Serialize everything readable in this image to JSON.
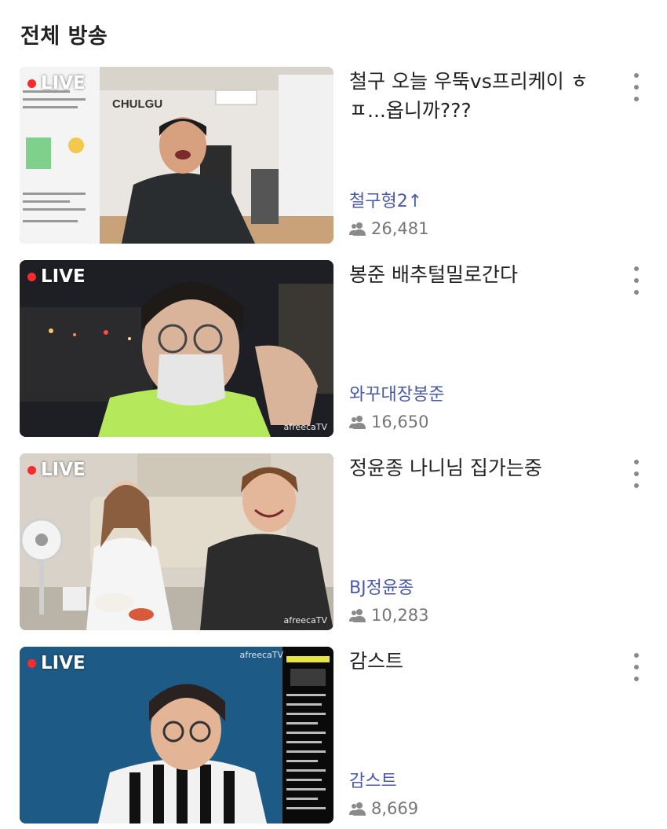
{
  "section": {
    "title": "전체 방송"
  },
  "streams": [
    {
      "live_label": "LIVE",
      "title": "철구 오늘 우뚝vs프리케이 ㅎㅍ...옵니까???",
      "streamer": "철구형2↑",
      "viewers": "26,481",
      "room_sign": "CHULGU"
    },
    {
      "live_label": "LIVE",
      "title": "봉준 배추털밀로간다",
      "streamer": "와꾸대장봉준",
      "viewers": "16,650",
      "watermark": "afreecaTV"
    },
    {
      "live_label": "LIVE",
      "title": "정윤종 나니님 집가는중",
      "streamer": "BJ정윤종",
      "viewers": "10,283",
      "watermark": "afreecaTV"
    },
    {
      "live_label": "LIVE",
      "title": "감스트",
      "streamer": "감스트",
      "viewers": "8,669",
      "watermark": "afreecaTV"
    }
  ],
  "icons": {
    "viewers": "people-icon",
    "more": "more-vertical-icon",
    "live": "live-dot-icon"
  },
  "colors": {
    "streamer_link": "#4a5aa8",
    "live_dot": "#ff2a2a",
    "meta_gray": "#777777"
  }
}
